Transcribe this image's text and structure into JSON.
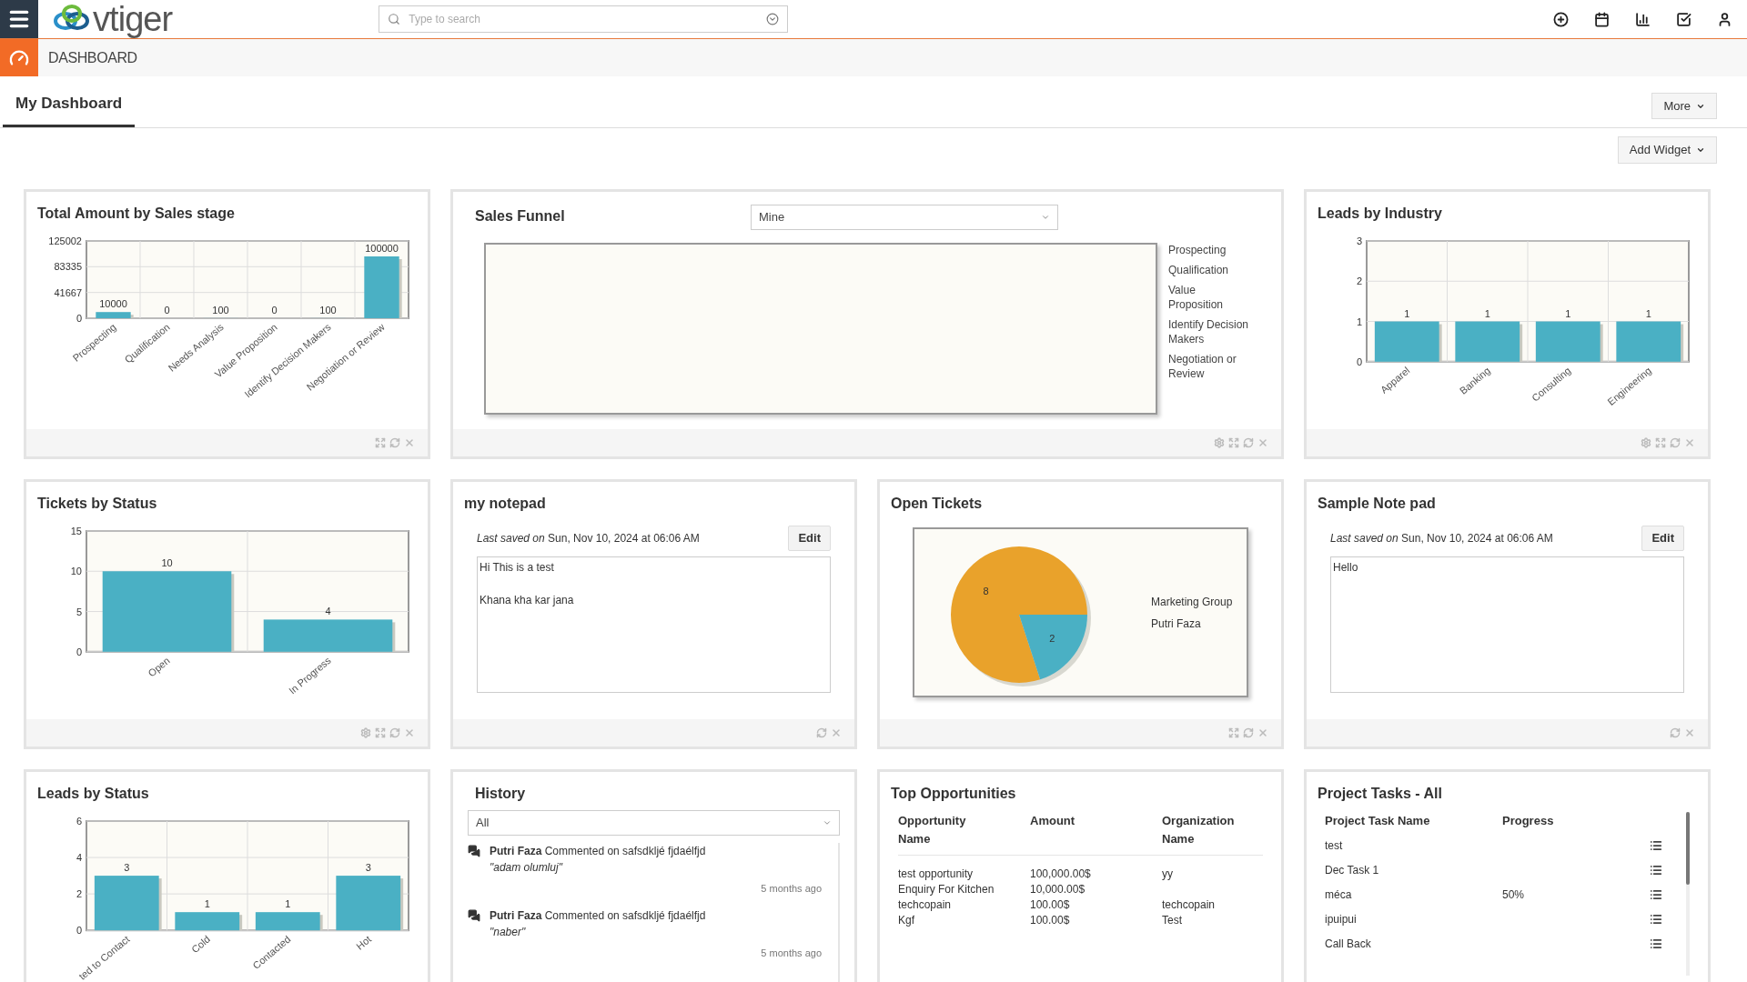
{
  "topbar": {
    "logo_text": "vtiger",
    "search": {
      "placeholder": "Type to search"
    }
  },
  "module_bar": {
    "title": "DASHBOARD"
  },
  "tabs": [
    {
      "label": "My Dashboard",
      "selected": true
    }
  ],
  "more_button": "More",
  "add_widget_button": "Add Widget",
  "widgets": [
    {
      "kind": "bar_chart",
      "title": "Total Amount by Sales stage",
      "footer": {
        "settings": false,
        "expand": true,
        "refresh": true,
        "close": true
      },
      "chart_data": {
        "type": "bar",
        "categories": [
          "Prospecting",
          "Qualification",
          "Needs Analysis",
          "Value Proposition",
          "Identify Decision Makers",
          "Negotiation or Review"
        ],
        "series": [
          {
            "color": "#4ab0c4",
            "values": [
              10000,
              0,
              100,
              0,
              100,
              100000
            ]
          }
        ],
        "ylim": [
          0,
          125002
        ],
        "yticks": [
          0,
          41667,
          83335,
          125002
        ],
        "data_labels": true
      }
    },
    {
      "kind": "funnel",
      "title": "Sales Funnel",
      "filter": "Mine",
      "legend": [
        "Prospecting",
        "Qualification",
        "Value Proposition",
        "Identify Decision Makers",
        "Negotiation or Review"
      ],
      "footer": {
        "settings": true,
        "expand": true,
        "refresh": true,
        "close": true
      }
    },
    {
      "kind": "bar_chart",
      "title": "Leads by Industry",
      "footer": {
        "settings": true,
        "expand": true,
        "refresh": true,
        "close": true
      },
      "chart_data": {
        "type": "bar",
        "categories": [
          "Apparel",
          "Banking",
          "Consulting",
          "Engineering"
        ],
        "series": [
          {
            "color": "#4ab0c4",
            "values": [
              1,
              1,
              1,
              1
            ]
          }
        ],
        "ylim": [
          0,
          3
        ],
        "yticks": [
          0,
          1,
          2,
          3
        ],
        "data_labels": true
      }
    },
    {
      "kind": "bar_chart",
      "title": "Tickets by Status",
      "footer": {
        "settings": true,
        "expand": true,
        "refresh": true,
        "close": true
      },
      "chart_data": {
        "type": "bar",
        "categories": [
          "Open",
          "In Progress"
        ],
        "series": [
          {
            "color": "#4ab0c4",
            "values": [
              10,
              4
            ]
          }
        ],
        "ylim": [
          0,
          15
        ],
        "yticks": [
          0,
          5,
          10,
          15
        ],
        "data_labels": true
      }
    },
    {
      "kind": "notepad",
      "title": "my notepad",
      "saved": "*Last saved on* Sun, Nov 10, 2024 at 06:06 AM",
      "edit_button": "Edit",
      "content": "Hi This is a test\n\nKhana kha kar jana",
      "footer": {
        "settings": false,
        "expand": false,
        "refresh": true,
        "close": true
      }
    },
    {
      "kind": "pie_chart",
      "title": "Open Tickets",
      "footer": {
        "settings": false,
        "expand": true,
        "refresh": true,
        "close": true
      },
      "chart_data": {
        "type": "pie",
        "categories": [
          "Marketing Group",
          "Putri Faza"
        ],
        "colors": [
          "#e9a22b",
          "#4ab0c4"
        ],
        "values": [
          8,
          2
        ],
        "data_labels": true
      }
    },
    {
      "kind": "notepad",
      "title": "Sample Note pad",
      "saved": "*Last saved on* Sun, Nov 10, 2024 at 06:06 AM",
      "edit_button": "Edit",
      "content": "Hello",
      "footer": {
        "settings": false,
        "expand": false,
        "refresh": true,
        "close": true
      }
    },
    {
      "kind": "bar_chart",
      "title": "Leads by Status",
      "chart_data": {
        "type": "bar",
        "categories": [
          "ted to Contact",
          "Cold",
          "Contacted",
          "Hot"
        ],
        "series": [
          {
            "color": "#4ab0c4",
            "values": [
              3,
              1,
              1,
              3
            ]
          }
        ],
        "ylim": [
          0,
          6
        ],
        "yticks": [
          0,
          2,
          4,
          6
        ],
        "data_labels": true
      }
    },
    {
      "kind": "history",
      "title": "History",
      "filter": "All",
      "items": [
        {
          "text": "**Putri Faza** Commented on safsdkljé fjdaélfjd",
          "quote": "\"adam olumluj\"",
          "time": "5 months ago"
        },
        {
          "text": "**Putri Faza** Commented on safsdkljé fjdaélfjd",
          "quote": "\"naber\"",
          "time": "5 months ago"
        }
      ]
    },
    {
      "kind": "table",
      "title": "Top Opportunities",
      "columns": [
        "Opportunity Name",
        "Amount",
        "Organization Name"
      ],
      "rows": [
        {
          "name": "test opportunity",
          "amount": "100,000.00$",
          "organization": "yy"
        },
        {
          "name": "Enquiry For Kitchen",
          "amount": "10,000.00$"
        },
        {
          "name": "techcopain",
          "amount": "100.00$",
          "organization": "techcopain"
        },
        {
          "name": "Kgf",
          "amount": "100.00$",
          "organization": "Test"
        }
      ]
    },
    {
      "kind": "tasks",
      "title": "Project Tasks - All",
      "columns": [
        "Project Task Name",
        "Progress"
      ],
      "rows": [
        {
          "name": "test"
        },
        {
          "name": "Dec Task 1"
        },
        {
          "name": "méca",
          "progress": "50%"
        },
        {
          "name": "ipuipui"
        },
        {
          "name": "Call Back"
        }
      ]
    }
  ]
}
